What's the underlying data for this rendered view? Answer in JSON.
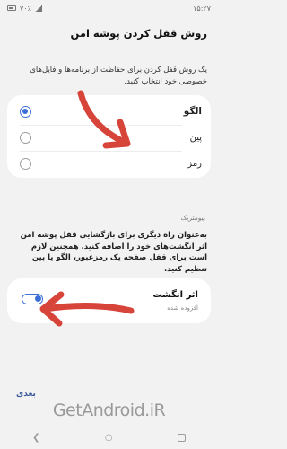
{
  "status_bar": {
    "time": "۱۵:۲۷",
    "battery": "۷۰٪"
  },
  "page_title": "روش قفل کردن پوشه امن",
  "intro_text": "یک روش قفل کردن برای حفاظت از برنامه‌ها و فایل‌های خصوصی خود انتخاب کنید.",
  "lock_options": [
    {
      "label": "الگو",
      "selected": true
    },
    {
      "label": "پین",
      "selected": false
    },
    {
      "label": "رمز",
      "selected": false
    }
  ],
  "biometrics": {
    "section_header": "بیومتریک",
    "description": "به‌عنوان راه دیگری برای بازگشایی قفل پوشه امن اثر انگشت‌های خود را اضافه کنید. همچنین لازم است برای قفل صفحه یک رمزعبور، الگو یا پین تنظیم کنید.",
    "fingerprint_title": "اثر انگشت",
    "fingerprint_subtitle": "افزوده شده",
    "fingerprint_enabled": true
  },
  "next_label": "بعدی",
  "watermark": "GetAndroid.iR",
  "colors": {
    "accent": "#3b6fd6",
    "arrow": "#d7443a",
    "background": "#f2f2f2"
  },
  "icons": [
    "battery-icon",
    "signal-icon",
    "radio-icon",
    "toggle-icon",
    "back-icon",
    "home-icon",
    "recents-icon",
    "arrow-annotation-icon"
  ]
}
